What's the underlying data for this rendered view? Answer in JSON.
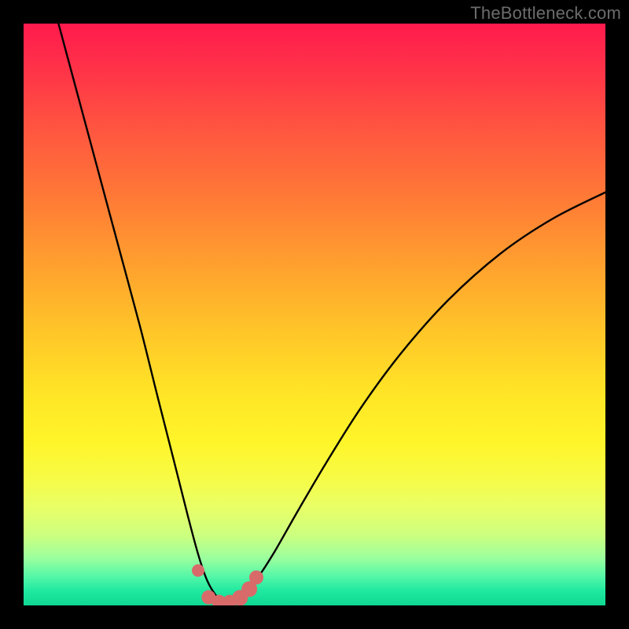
{
  "watermark": "TheBottleneck.com",
  "chart_data": {
    "type": "line",
    "title": "",
    "xlabel": "",
    "ylabel": "",
    "xlim": [
      0,
      1
    ],
    "ylim": [
      0,
      1
    ],
    "series": [
      {
        "name": "bottleneck-curve",
        "x": [
          0.06,
          0.095,
          0.13,
          0.165,
          0.2,
          0.23,
          0.258,
          0.282,
          0.3,
          0.315,
          0.33,
          0.345,
          0.36,
          0.378,
          0.4,
          0.43,
          0.47,
          0.52,
          0.58,
          0.65,
          0.73,
          0.82,
          0.91,
          1.0
        ],
        "y": [
          1.0,
          0.87,
          0.74,
          0.61,
          0.48,
          0.36,
          0.25,
          0.155,
          0.088,
          0.044,
          0.018,
          0.005,
          0.005,
          0.018,
          0.044,
          0.09,
          0.16,
          0.245,
          0.34,
          0.435,
          0.525,
          0.605,
          0.665,
          0.71
        ]
      }
    ],
    "markers": {
      "name": "highlight-dots",
      "color": "#d86a6a",
      "points": [
        {
          "x": 0.3,
          "y": 0.06,
          "r": 8
        },
        {
          "x": 0.318,
          "y": 0.014,
          "r": 9
        },
        {
          "x": 0.336,
          "y": 0.006,
          "r": 9
        },
        {
          "x": 0.354,
          "y": 0.006,
          "r": 9
        },
        {
          "x": 0.372,
          "y": 0.013,
          "r": 10
        },
        {
          "x": 0.388,
          "y": 0.028,
          "r": 10
        },
        {
          "x": 0.4,
          "y": 0.048,
          "r": 9
        }
      ]
    },
    "colors": {
      "curve": "#000000",
      "marker": "#d86a6a",
      "gradient_top": "#ff1a4d",
      "gradient_bottom": "#0fd892",
      "frame": "#000000"
    }
  }
}
